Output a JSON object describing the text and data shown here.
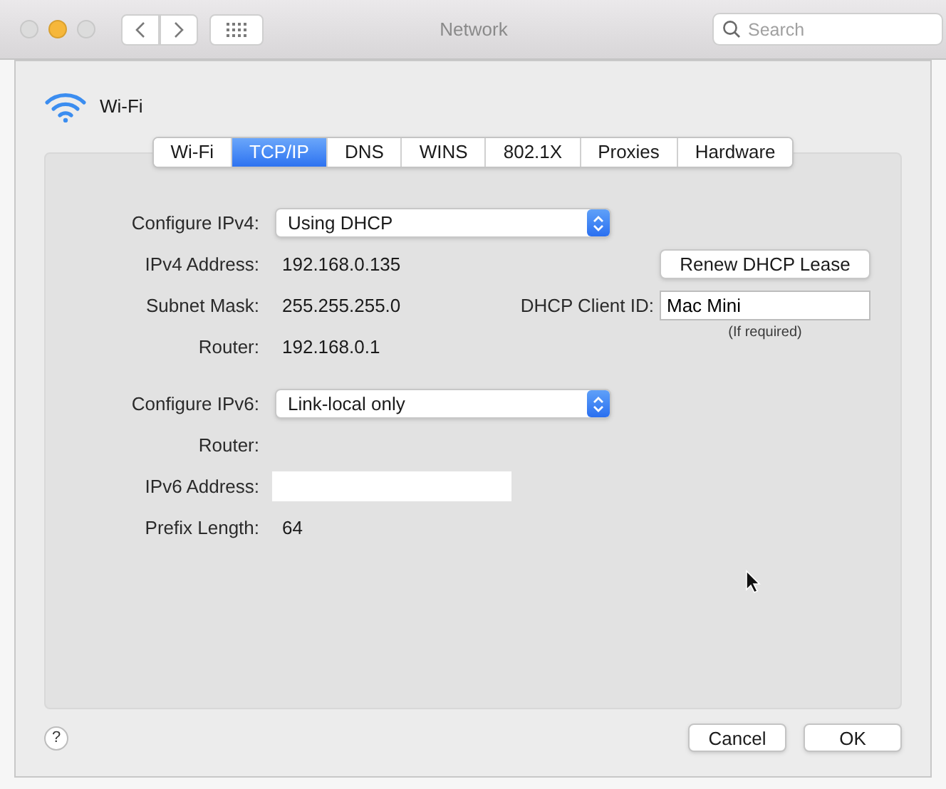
{
  "window": {
    "title": "Network"
  },
  "toolbar": {
    "search": {
      "placeholder": "Search"
    }
  },
  "interface": {
    "name": "Wi-Fi"
  },
  "tabs": [
    {
      "label": "Wi-Fi",
      "selected": false
    },
    {
      "label": "TCP/IP",
      "selected": true
    },
    {
      "label": "DNS",
      "selected": false
    },
    {
      "label": "WINS",
      "selected": false
    },
    {
      "label": "802.1X",
      "selected": false
    },
    {
      "label": "Proxies",
      "selected": false
    },
    {
      "label": "Hardware",
      "selected": false
    }
  ],
  "ipv4": [
    {
      "kind": "select",
      "label": "Configure IPv4:",
      "value": "Using DHCP"
    },
    {
      "kind": "text",
      "label": "IPv4 Address:",
      "value": "192.168.0.135"
    },
    {
      "kind": "text",
      "label": "Subnet Mask:",
      "value": "255.255.255.0"
    },
    {
      "kind": "text",
      "label": "Router:",
      "value": "192.168.0.1"
    }
  ],
  "dhcp": {
    "renew_button": "Renew DHCP Lease",
    "client_id_label": "DHCP Client ID:",
    "client_id_value": "Mac Mini",
    "hint": "(If required)"
  },
  "ipv6": [
    {
      "kind": "select",
      "label": "Configure IPv6:",
      "value": "Link-local only"
    },
    {
      "kind": "text",
      "label": "Router:"
    },
    {
      "kind": "field",
      "label": "IPv6 Address:"
    },
    {
      "kind": "text",
      "label": "Prefix Length:",
      "value": "64"
    }
  ],
  "footer": {
    "help": "?",
    "buttons": [
      "Cancel",
      "OK"
    ]
  }
}
